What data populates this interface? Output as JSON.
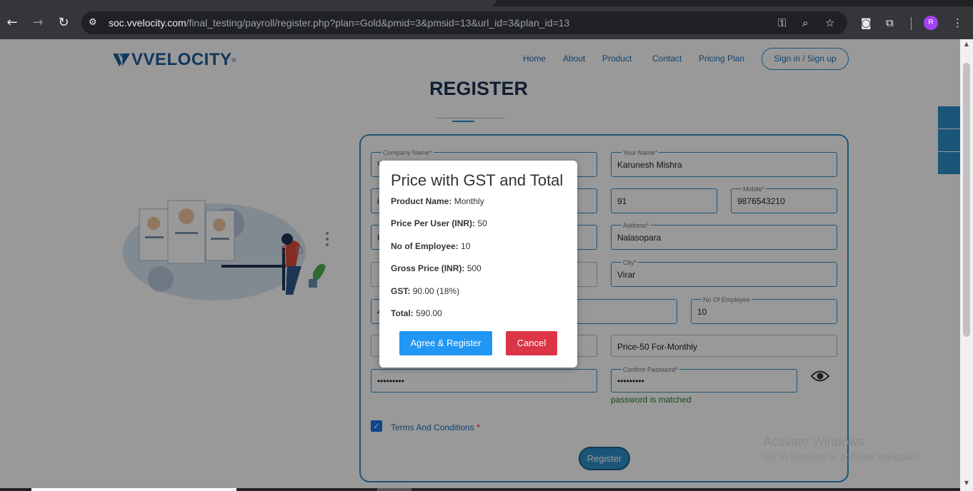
{
  "browser": {
    "url_host": "soc.vvelocity.com",
    "url_path": "/final_testing/payroll/register.php?plan=Gold&pmid=3&pmsid=13&url_id=3&plan_id=13",
    "profile_initial": "R"
  },
  "header": {
    "logo_text": "VVELOCITY",
    "logo_reg": "®",
    "nav": [
      "Home",
      "About",
      "Product",
      "Contact",
      "Pricing Plan"
    ],
    "signin_label": "Sign in / Sign up"
  },
  "page": {
    "title": "REGISTER"
  },
  "form": {
    "company_label": "Company Name*",
    "company_value": "V",
    "your_name_label": "Your Name*",
    "your_name_value": "Karunesh Mishra",
    "row2_left_value": "i",
    "country_code_value": "91",
    "mobile_label": "Mobile*",
    "mobile_value": "9876543210",
    "row3_left_value": "I",
    "address_label": "Address*",
    "address_value": "Nalasopara",
    "city_label": "City*",
    "city_value": "Virar",
    "row5_left_value": "4",
    "employees_label": "No Of Employee",
    "employees_value": "10",
    "plan_value": "Price-50 For-Monthly",
    "password_value": "•••••••••",
    "confirm_label": "Confirm Password*",
    "confirm_value": "•••••••••",
    "password_status": "password is matched",
    "terms_label": "Terms And Conditions",
    "terms_required": "*",
    "terms_checked": true,
    "register_label": "Register"
  },
  "modal": {
    "title": "Price with GST and Total",
    "rows": [
      {
        "label": "Product Name:",
        "value": "Monthly"
      },
      {
        "label": "Price Per User (INR):",
        "value": "50"
      },
      {
        "label": "No of Employee:",
        "value": "10"
      },
      {
        "label": "Gross Price (INR):",
        "value": "500"
      },
      {
        "label": "GST:",
        "value": "90.00 (18%)"
      },
      {
        "label": "Total:",
        "value": "590.00"
      }
    ],
    "agree_label": "Agree & Register",
    "cancel_label": "Cancel"
  },
  "windows_watermark": {
    "line1": "Activate Windows",
    "line2": "Go to Settings to activate Windows."
  },
  "colors": {
    "brand": "#1c5d99",
    "accent": "#2d8ec6",
    "agree": "#2196f3",
    "cancel": "#dc3545"
  }
}
